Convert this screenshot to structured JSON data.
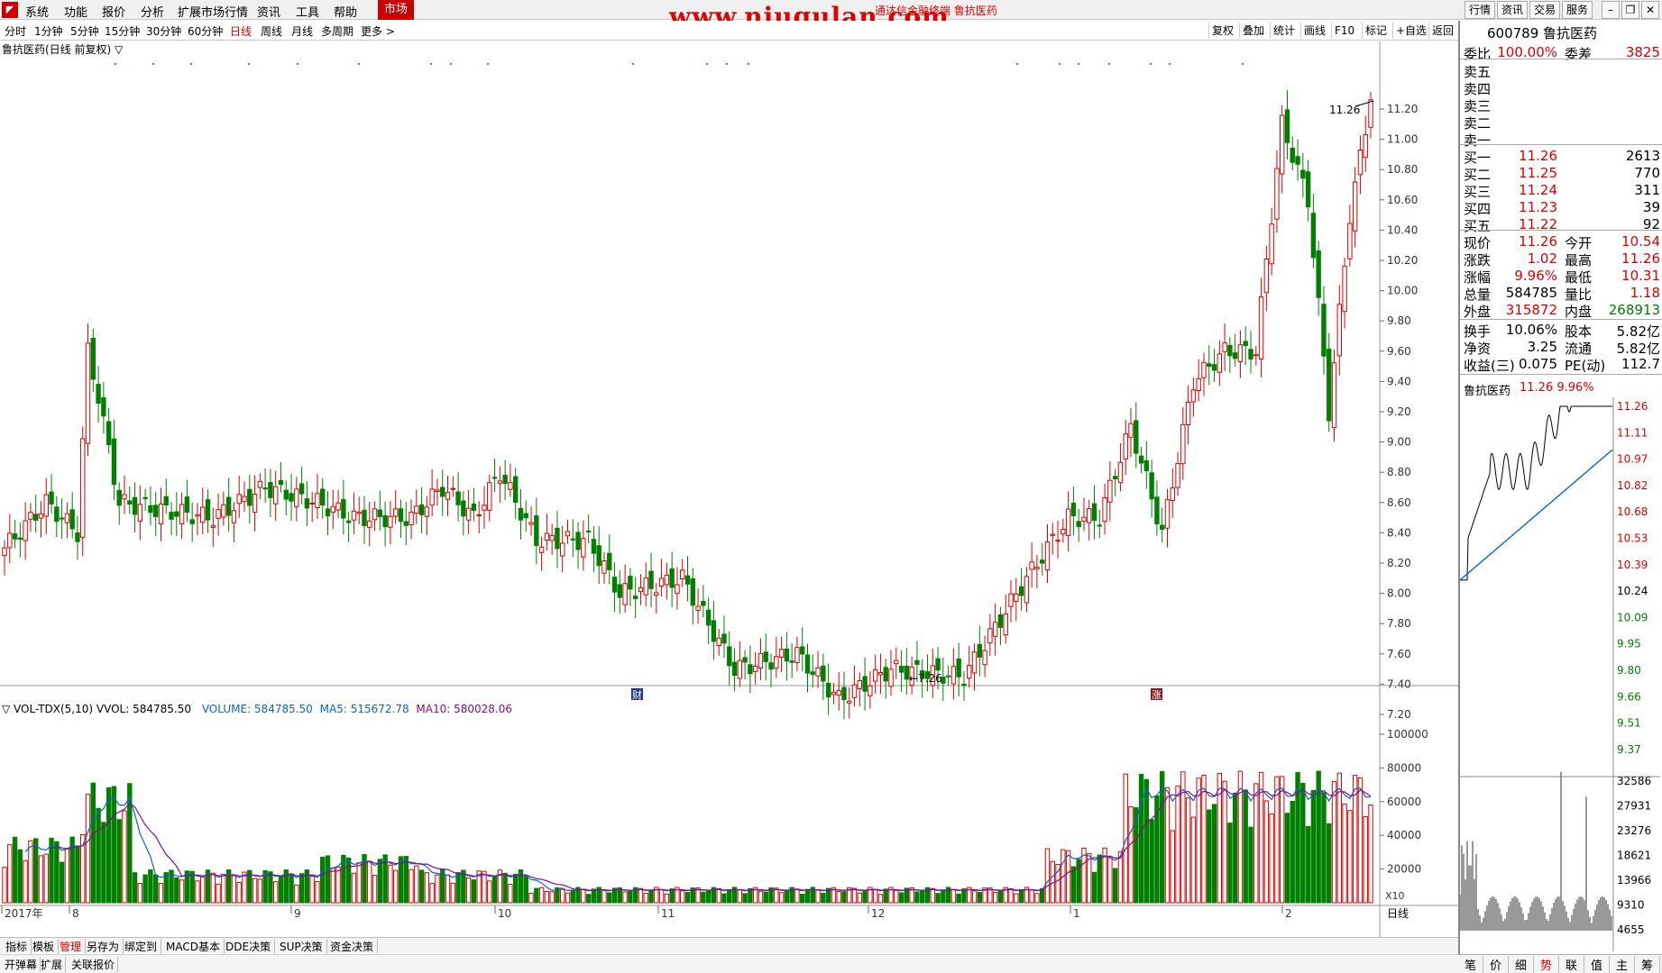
{
  "menu": {
    "items": [
      "系统",
      "功能",
      "报价",
      "分析",
      "扩展市场行情",
      "资讯",
      "工具",
      "帮助"
    ],
    "market": "市场",
    "watermark": "www.niugulan.com",
    "site": "通达信金融终端  鲁抗医药",
    "right": [
      "行情",
      "资讯",
      "交易",
      "服务"
    ]
  },
  "period": {
    "items": [
      "分时",
      "1分钟",
      "5分钟",
      "15分钟",
      "30分钟",
      "60分钟",
      "日线",
      "周线",
      "月线",
      "多周期",
      "更多 >"
    ],
    "active": "日线",
    "tools": [
      "复权",
      "叠加",
      "统计",
      "画线",
      "F10",
      "标记",
      "+自选",
      "返回"
    ]
  },
  "chart": {
    "title": "鲁抗医药(日线 前复权) ▽",
    "high_label": "11.26",
    "low_label": "7.26",
    "markers": [
      "财",
      "涨"
    ],
    "date_labels": [
      "2017年",
      "8",
      "9",
      "10",
      "11",
      "12",
      "1",
      "2"
    ],
    "vol_header": {
      "name": "▽ VOL-TDX(5,10)",
      "vvol": "VVOL: 584785.50",
      "volume": "VOLUME: 584785.50",
      "ma5": "MA5: 515672.78",
      "ma10": "MA10: 580028.06"
    },
    "vol_scale": "X10",
    "period_label": "日线"
  },
  "axes": {
    "price": [
      "11.20",
      "11.00",
      "10.80",
      "10.60",
      "10.40",
      "10.20",
      "10.00",
      "9.80",
      "9.60",
      "9.40",
      "9.20",
      "9.00",
      "8.80",
      "8.60",
      "8.40",
      "8.20",
      "8.00",
      "7.80",
      "7.60",
      "7.40",
      "7.20"
    ],
    "volume": [
      "100000",
      "80000",
      "60000",
      "40000",
      "20000"
    ]
  },
  "colors": {
    "up": "#e00000",
    "down": "#008000",
    "bg": "#ffffff",
    "vol_ma5": "#0a64c8",
    "vol_ma10": "#8a0a8a"
  },
  "chart_data": {
    "type": "candlestick",
    "x_range": [
      "2017-07",
      "2018-02"
    ],
    "y_range": [
      7.2,
      11.26
    ],
    "last": {
      "open": 10.54,
      "high": 11.26,
      "low": 10.31,
      "close": 11.26,
      "volume": 584785
    },
    "prev_close": 10.24,
    "period_high": 11.26,
    "period_low": 7.26,
    "volume_ma5": 515672.78,
    "volume_ma10": 580028.06
  },
  "quote": {
    "code": "600789",
    "name": "鲁抗医药",
    "weibi_label": "委比",
    "weibi": "100.00%",
    "weicha_label": "委差",
    "weicha": "3825",
    "sells": [
      {
        "label": "卖五"
      },
      {
        "label": "卖四"
      },
      {
        "label": "卖三"
      },
      {
        "label": "卖二"
      },
      {
        "label": "卖一"
      }
    ],
    "buys": [
      {
        "label": "买一",
        "price": "11.26",
        "vol": "2613"
      },
      {
        "label": "买二",
        "price": "11.25",
        "vol": "770"
      },
      {
        "label": "买三",
        "price": "11.24",
        "vol": "311"
      },
      {
        "label": "买四",
        "price": "11.23",
        "vol": "39"
      },
      {
        "label": "买五",
        "price": "11.22",
        "vol": "92"
      }
    ],
    "stats": [
      {
        "l1": "现价",
        "v1": "11.26",
        "l2": "今开",
        "v2": "10.54",
        "c1": "red",
        "c2": "red"
      },
      {
        "l1": "涨跌",
        "v1": "1.02",
        "l2": "最高",
        "v2": "11.26",
        "c1": "red",
        "c2": "red"
      },
      {
        "l1": "涨幅",
        "v1": "9.96%",
        "l2": "最低",
        "v2": "10.31",
        "c1": "red",
        "c2": "red"
      },
      {
        "l1": "总量",
        "v1": "584785",
        "l2": "量比",
        "v2": "1.18",
        "c1": "",
        "c2": "red"
      },
      {
        "l1": "外盘",
        "v1": "315872",
        "l2": "内盘",
        "v2": "268913",
        "c1": "red",
        "c2": "grn"
      },
      {
        "l1": "换手",
        "v1": "10.06%",
        "l2": "股本",
        "v2": "5.82亿",
        "c1": "",
        "c2": ""
      },
      {
        "l1": "净资",
        "v1": "3.25",
        "l2": "流通",
        "v2": "5.82亿",
        "c1": "",
        "c2": ""
      },
      {
        "l1": "收益(三)",
        "v1": "0.075",
        "l2": "PE(动)",
        "v2": "112.7",
        "c1": "",
        "c2": ""
      }
    ]
  },
  "mini": {
    "title": "鲁抗医药",
    "price": "11.26",
    "pct": "9.96%",
    "price_axis": [
      "11.26",
      "11.11",
      "10.97",
      "10.82",
      "10.68",
      "10.53",
      "10.39",
      "10.24",
      "10.09",
      "9.95",
      "9.80",
      "9.66",
      "9.51",
      "9.37"
    ],
    "vol_axis": [
      "32586",
      "27931",
      "23276",
      "18621",
      "13966",
      "9310",
      "4655"
    ]
  },
  "bottom": {
    "row1": [
      "指标",
      "模板",
      "管理",
      "另存为",
      "绑定到",
      "MACD基本",
      "DDE决策",
      "SUP决策",
      "资金决策"
    ],
    "row2": [
      "开弹幕",
      "扩展",
      "关联报价"
    ],
    "tabs": [
      "笔",
      "价",
      "细",
      "势",
      "联",
      "值",
      "主",
      "筹"
    ],
    "active_tab": "势"
  }
}
